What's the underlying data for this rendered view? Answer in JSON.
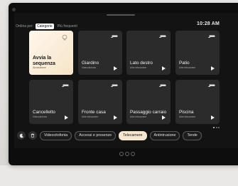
{
  "sort": {
    "label": "Ordina per:",
    "options": [
      "Categorie",
      "Più frequenti"
    ],
    "selected": "Categorie"
  },
  "clock": "10:28 AM",
  "tiles": [
    {
      "name": "Avvia la sequenza",
      "sub": "Illuminazione",
      "icon": "bulb-icon",
      "active": true
    },
    {
      "name": "Giardino",
      "sub": "Videocitofonia",
      "icon": "camera-icon",
      "active": false
    },
    {
      "name": "Lato destro",
      "sub": "Altre telecamere",
      "icon": "camera-icon",
      "active": false
    },
    {
      "name": "Patio",
      "sub": "Altre telecamere",
      "icon": "camera-icon",
      "active": false
    },
    {
      "name": "Cancelletto",
      "sub": "Videocitofonia",
      "icon": "camera-icon",
      "active": false
    },
    {
      "name": "Fronte casa",
      "sub": "Altre telecamere",
      "icon": "camera-icon",
      "active": false
    },
    {
      "name": "Passaggio carraio",
      "sub": "Altre telecamere",
      "icon": "camera-icon",
      "active": false
    },
    {
      "name": "Piscina",
      "sub": "Altre telecamere",
      "icon": "camera-icon",
      "active": false
    }
  ],
  "filters": {
    "chips": [
      "Videocitofonia",
      "Accessi e presenze",
      "Telecamere",
      "Antintrusione",
      "Tende"
    ],
    "selected": "Telecamere"
  },
  "colors": {
    "active_tile": "#f6e4c8",
    "tile": "#2b2b2b",
    "screen": "#131313"
  }
}
